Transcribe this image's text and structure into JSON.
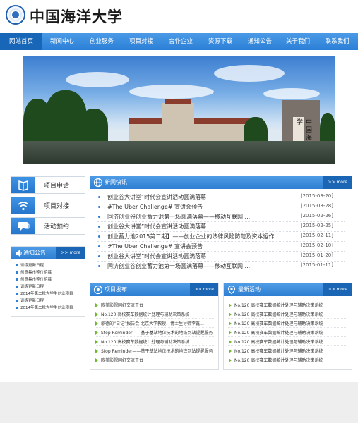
{
  "header": {
    "logo_text": "中国海洋大学"
  },
  "nav": {
    "items": [
      {
        "label": "网站首页",
        "active": true
      },
      {
        "label": "新闻中心"
      },
      {
        "label": "创业服务"
      },
      {
        "label": "项目对接"
      },
      {
        "label": "合作企业"
      },
      {
        "label": "资源下载"
      },
      {
        "label": "通知公告"
      },
      {
        "label": "关于我们"
      },
      {
        "label": "联系我们"
      }
    ]
  },
  "banner": {
    "gate_text": "中国海洋大学"
  },
  "side_buttons": [
    {
      "label": "项目申请",
      "icon": "book-icon"
    },
    {
      "label": "项目对接",
      "icon": "wifi-icon"
    },
    {
      "label": "活动预约",
      "icon": "chat-icon"
    }
  ],
  "notices": {
    "title": "通知公告",
    "more": ">> more",
    "items": [
      "训练更新日程",
      "创意集市等位招募",
      "创意集市等位招募",
      "训练更新日程",
      "2014年第二批大学生创业项目",
      "训练更新日程",
      "2014年第二批大学生创业项目"
    ]
  },
  "news": {
    "title": "新闻快讯",
    "more": ">> more",
    "items": [
      {
        "title": "创业谷大讲堂”时代会宣讲活动圆满落幕",
        "date": "[2015-03-20]"
      },
      {
        "title": "#The Uber Challenge# 宣讲会预告",
        "date": "[2015-03-28]"
      },
      {
        "title": "同济创业谷创业蓄力池第一场圆满落幕——移动互联网 ...",
        "date": "[2015-02-26]"
      },
      {
        "title": "创业谷大讲堂”时代会宣讲活动圆满落幕",
        "date": "[2015-02-25]"
      },
      {
        "title": "创业蓄力池2015第二期】——创业企业的法律风险防范及资本运作",
        "date": "[2015-02-11]"
      },
      {
        "title": "#The Uber Challenge# 宣讲会预告",
        "date": "[2015-02-10]"
      },
      {
        "title": "创业谷大讲堂”时代会宣讲活动圆满落幕",
        "date": "[2015-01-20]"
      },
      {
        "title": "同济创业谷创业蓄力池第一场圆满落幕——移动互联网 ...",
        "date": "[2015-01-11]"
      }
    ]
  },
  "projects": {
    "title": "项目发布",
    "more": ">> more",
    "items": [
      "欧美影视同好交流平台",
      "No.120 高校赛车数据统计处理与辅助决策系统",
      "歌德的“日记”报告会 北京大学教授、博士生导师李鑫...",
      "Stop Reminder——基于基站地位技术的地铁到站提醒服务",
      "No.120 高校赛车数据统计处理与辅助决策系统",
      "Stop Reminder——基于基站地位技术的地铁到站提醒服务",
      "欧美影视同好交流平台"
    ]
  },
  "activities": {
    "title": "最新活动",
    "more": ">> more",
    "items": [
      "No.120 高校赛车数据统计处理与辅助决策系统",
      "No.120 高校赛车数据统计处理与辅助决策系统",
      "No.120 高校赛车数据统计处理与辅助决策系统",
      "No.120 高校赛车数据统计处理与辅助决策系统",
      "No.120 高校赛车数据统计处理与辅助决策系统",
      "No.120 高校赛车数据统计处理与辅助决策系统",
      "No.120 高校赛车数据统计处理与辅助决策系统"
    ]
  }
}
